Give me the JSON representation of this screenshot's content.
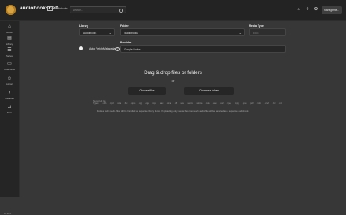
{
  "header": {
    "app_title": "audiobookshelf",
    "library_switch": "Audiobooks",
    "search_placeholder": "Search...",
    "user_button": "manageme..."
  },
  "sidebar": {
    "items": [
      {
        "label": "Home",
        "icon": "home-icon"
      },
      {
        "label": "Library",
        "icon": "library-icon"
      },
      {
        "label": "Series",
        "icon": "series-icon"
      },
      {
        "label": "Collections",
        "icon": "collections-icon"
      },
      {
        "label": "Authors",
        "icon": "authors-icon"
      },
      {
        "label": "Narrators",
        "icon": "narrators-icon"
      },
      {
        "label": "Stats",
        "icon": "stats-icon"
      }
    ],
    "version": "v2.28.0"
  },
  "form": {
    "library_label": "Library",
    "library_value": "Audiobooks",
    "folder_label": "Folder",
    "folder_value": "/audiobooks",
    "media_type_label": "Media Type",
    "media_type_value": "Book",
    "provider_label": "Provider",
    "provider_value": "Google Books",
    "auto_fetch_label": "Auto Fetch Metadata",
    "auto_fetch_enabled": true
  },
  "dropzone": {
    "title": "Drag & drop files or folders",
    "or": "or",
    "choose_files": "Choose files",
    "choose_folder": "Choose a folder",
    "supported_label": "Supported File Types:",
    "file_types": [
      ".m4b",
      ".mp3",
      ".m4a",
      ".flac",
      ".opus",
      ".ogg",
      ".oga",
      ".mp4",
      ".aac",
      ".wma",
      ".aiff",
      ".wav",
      ".webm",
      ".webma",
      ".mka",
      ".awb",
      ".caf",
      ".mpeg",
      ".mpg",
      ".epub",
      ".pdf",
      ".mobi",
      ".azw3",
      ".cbr",
      ".cbz"
    ],
    "note": "Folders with media files will be handled as separate library items. If uploading only media files then each audio file will be handled as a separate audiobook."
  }
}
